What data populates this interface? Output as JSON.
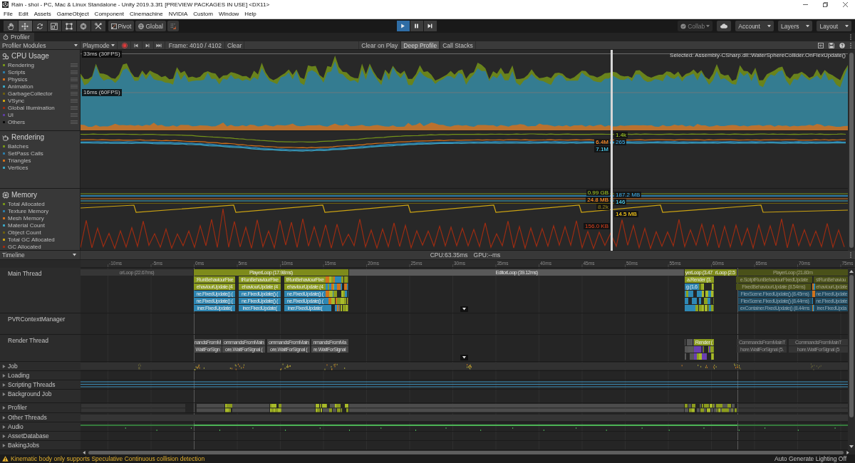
{
  "window": {
    "title": "Rain - shoi - PC, Mac & Linux Standalone - Unity 2019.3.3f1 [PREVIEW PACKAGES IN USE] <DX11>"
  },
  "menu": [
    "File",
    "Edit",
    "Assets",
    "GameObject",
    "Component",
    "Cinemachine",
    "NVIDIA",
    "Custom",
    "Window",
    "Help"
  ],
  "toolbar": {
    "tools": [
      {
        "kind": "hand",
        "selected": false
      },
      {
        "kind": "move",
        "selected": true
      },
      {
        "kind": "rotate",
        "selected": false
      },
      {
        "kind": "scale",
        "selected": false
      },
      {
        "kind": "rect",
        "selected": false
      },
      {
        "kind": "transform",
        "selected": false
      },
      {
        "kind": "custom",
        "selected": false
      }
    ],
    "pivot": "Pivot",
    "space": "Global",
    "playback": [
      {
        "kind": "play",
        "on": true
      },
      {
        "kind": "pause",
        "on": false
      },
      {
        "kind": "step",
        "on": false
      }
    ],
    "collab": {
      "label": "Collab",
      "disabled": true
    },
    "dropdowns": [
      "Account",
      "Layers",
      "Layout"
    ]
  },
  "profiler": {
    "tab": "Profiler",
    "modules_menu": "Profiler Modules",
    "target": "Playmode",
    "recording": true,
    "frame": "Frame: 4010 / 4102",
    "clear": "Clear",
    "toggles": [
      {
        "label": "Clear on Play",
        "on": false
      },
      {
        "label": "Deep Profile",
        "on": true
      },
      {
        "label": "Call Stacks",
        "on": false
      }
    ],
    "selected_sample": "Selected: Assembly-CSharp.dll::WaterSphereCollider.OnFlexUpdate()",
    "modules": [
      {
        "kind": "cpu",
        "title": "CPU Usage",
        "guides": [
          "33ms (30FPS)",
          "16ms (60FPS)"
        ],
        "series": [
          {
            "name": "Rendering",
            "color": "#74931a"
          },
          {
            "name": "Scripts",
            "color": "#2c7ba6"
          },
          {
            "name": "Physics",
            "color": "#d2701c"
          },
          {
            "name": "Animation",
            "color": "#3aa5c2"
          },
          {
            "name": "GarbageCollector",
            "color": "#6b5e10"
          },
          {
            "name": "VSync",
            "color": "#cda412"
          },
          {
            "name": "Global Illumination",
            "color": "#9c2c12"
          },
          {
            "name": "UI",
            "color": "#5c3c9f"
          },
          {
            "name": "Others",
            "color": "#0a0a0a"
          }
        ]
      },
      {
        "kind": "rendering",
        "title": "Rendering",
        "series": [
          {
            "name": "Batches",
            "color": "#74931a",
            "readout": "1.4k"
          },
          {
            "name": "SetPass Calls",
            "color": "#2c7ba6",
            "readout": "265"
          },
          {
            "name": "Triangles",
            "color": "#d2701c",
            "readout": "6.4M"
          },
          {
            "name": "Vertices",
            "color": "#3aa5c2",
            "readout": "7.1M"
          }
        ]
      },
      {
        "kind": "memory",
        "title": "Memory",
        "series": [
          {
            "name": "Total Allocated",
            "color": "#74931a",
            "readout": "0.99 GB"
          },
          {
            "name": "Texture Memory",
            "color": "#2c7ba6",
            "readout": "187.2 MB"
          },
          {
            "name": "Mesh Memory",
            "color": "#d2701c",
            "readout": "24.8 MB"
          },
          {
            "name": "Material Count",
            "color": "#3aa5c2",
            "readout": "146"
          },
          {
            "name": "Object Count",
            "color": "#6b5e10",
            "readout": "8.2k"
          },
          {
            "name": "Total GC Allocated",
            "color": "#cda412",
            "readout": "14.5 MB"
          },
          {
            "name": "GC Allocated",
            "color": "#9c2c12",
            "readout": "156.0 KB"
          }
        ]
      }
    ]
  },
  "timeline": {
    "view": "Timeline",
    "summary": [
      "CPU:63.35ms",
      "GPU:--ms"
    ],
    "ruler": [
      "-10ms",
      "-5ms",
      "0ms",
      "5ms",
      "10ms",
      "15ms",
      "20ms",
      "25ms",
      "30ms",
      "35ms",
      "40ms",
      "45ms",
      "50ms",
      "55ms",
      "60ms",
      "65ms",
      "70ms",
      "75ms"
    ],
    "threads": [
      {
        "kind": "thread",
        "name": "Main Thread",
        "lanes": [
          [
            {
              "label": "orLoop (22.67ms)",
              "kind": "editor",
              "dimmed": true
            },
            {
              "label": "PlayerLoop (17.98ms)",
              "kind": "loop",
              "dimmed": false
            },
            {
              "label": "EditorLoop (39.12ms)",
              "kind": "editor",
              "dimmed": false
            },
            {
              "label": "yerLoop (3.47",
              "kind": "loop",
              "dimmed": false
            },
            {
              "label": "rLoop (2.5",
              "kind": "loop",
              "dimmed": false
            },
            {
              "label": "PlayerLoop (21.80m",
              "kind": "loop",
              "dimmed": true
            }
          ],
          [
            {
              "label": ":RunBehaviourFixe",
              "kind": "behaviour",
              "dimmed": false
            },
            {
              "label": "tRunBehaviourFixe",
              "kind": "behaviour",
              "dimmed": false
            },
            {
              "label": "tRunBehaviourFixe",
              "kind": "behaviour",
              "dimmed": false
            },
            {
              "label": "a.Render (3.",
              "kind": "behaviour",
              "dimmed": false
            },
            {
              "label": "e.ScriptRunBehaviourFixedUpdate",
              "kind": "behaviour",
              "dimmed": true
            },
            {
              "label": "stRunBehaviou",
              "kind": "behaviour",
              "dimmed": true
            }
          ],
          [
            {
              "label": "ehaviourUpdate (4",
              "kind": "behaviour",
              "dimmed": false
            },
            {
              "label": "ehaviourUpdate (4",
              "kind": "behaviour",
              "dimmed": false
            },
            {
              "label": "ehaviourUpdate (4",
              "kind": "behaviour",
              "dimmed": false
            },
            {
              "label": "g (1.6",
              "kind": "fixed",
              "dimmed": false
            },
            {
              "label": "FixedBehaviourUpdate (8.54ms)",
              "kind": "behaviour",
              "dimmed": true
            },
            {
              "label": "ehaviourUpdate",
              "kind": "behaviour",
              "dimmed": true
            }
          ],
          [
            {
              "label": "ne.FixedUpdate() (",
              "kind": "fixed",
              "dimmed": false
            },
            {
              "label": "ne.FixedUpdate() (",
              "kind": "fixed",
              "dimmed": false
            },
            {
              "label": "ne.FixedUpdate() (",
              "kind": "fixed",
              "dimmed": false
            },
            {
              "label": "FlexScene.FixedUpdate() (8.45ms)",
              "kind": "fixed",
              "dimmed": true
            },
            {
              "label": "ne.FixedUpdate",
              "kind": "fixed",
              "dimmed": true
            }
          ],
          [
            {
              "label": "ne.FixedUpdate() (",
              "kind": "fixed",
              "dimmed": false
            },
            {
              "label": "ne.FixedUpdate() (",
              "kind": "fixed",
              "dimmed": false
            },
            {
              "label": "ne.FixedUpdate() (",
              "kind": "fixed",
              "dimmed": false
            },
            {
              "label": "FlexScene.FixedUpdate() (8.44ms)",
              "kind": "fixed",
              "dimmed": true
            },
            {
              "label": "ne.FixedUpdate",
              "kind": "fixed",
              "dimmed": true
            }
          ],
          [
            {
              "label": "iner.FixedUpdate(",
              "kind": "fixed",
              "dimmed": false
            },
            {
              "label": "iner.FixedUpdate(",
              "kind": "fixed",
              "dimmed": false
            },
            {
              "label": "iner.FixedUpdate(",
              "kind": "fixed",
              "dimmed": false
            },
            {
              "label": "exContainer.FixedUpdate() (8.44ms",
              "kind": "fixed",
              "dimmed": true
            },
            {
              "label": "iner.FixedUpda",
              "kind": "fixed",
              "dimmed": true
            }
          ]
        ]
      },
      {
        "kind": "thread",
        "name": "PVRContextManager"
      },
      {
        "kind": "thread",
        "name": "Render Thread",
        "lanes": [
          [
            {
              "label": "nandsFromM",
              "kind": "command",
              "dimmed": false
            },
            {
              "label": "ommandsFromMain",
              "kind": "command",
              "dimmed": false
            },
            {
              "label": "ommandsFromMain",
              "kind": "command",
              "dimmed": false
            },
            {
              "label": "nmandsFromMa",
              "kind": "command",
              "dimmed": false
            },
            {
              "label": "Render (",
              "kind": "behaviour",
              "dimmed": false
            },
            {
              "label": "CommandsFromMainT",
              "kind": "command",
              "dimmed": true
            },
            {
              "label": "CommandsFromMainT",
              "kind": "command",
              "dimmed": true
            }
          ],
          [
            {
              "label": "WaitForSign",
              "kind": "command",
              "dimmed": false
            },
            {
              "label": "ore.WaitForSignal (",
              "kind": "command",
              "dimmed": false
            },
            {
              "label": "ore.WaitForSignal (",
              "kind": "command",
              "dimmed": false
            },
            {
              "label": "re.WaitForSignal",
              "kind": "command",
              "dimmed": false
            },
            {
              "label": "hore.WaitForSignal (5.",
              "kind": "command",
              "dimmed": true
            },
            {
              "label": "hore.WaitForSignal (5",
              "kind": "command",
              "dimmed": true
            }
          ]
        ]
      },
      {
        "kind": "group",
        "name": "Job",
        "expanded": false
      },
      {
        "kind": "group",
        "name": "Loading",
        "expanded": false
      },
      {
        "kind": "group",
        "name": "Scripting Threads",
        "expanded": false
      },
      {
        "kind": "group",
        "name": "Background Job",
        "expanded": false
      },
      {
        "kind": "group",
        "name": "Profiler",
        "expanded": false
      },
      {
        "kind": "group",
        "name": "Other Threads",
        "expanded": false
      },
      {
        "kind": "group",
        "name": "Audio",
        "expanded": false
      },
      {
        "kind": "group",
        "name": "AssetDatabase",
        "expanded": false
      },
      {
        "kind": "group",
        "name": "BakingJobs",
        "expanded": false
      }
    ]
  },
  "status_bar": {
    "warning": "Kinematic body only supports Speculative Continuous collision detection",
    "lighting": "Auto Generate Lighting Off"
  }
}
